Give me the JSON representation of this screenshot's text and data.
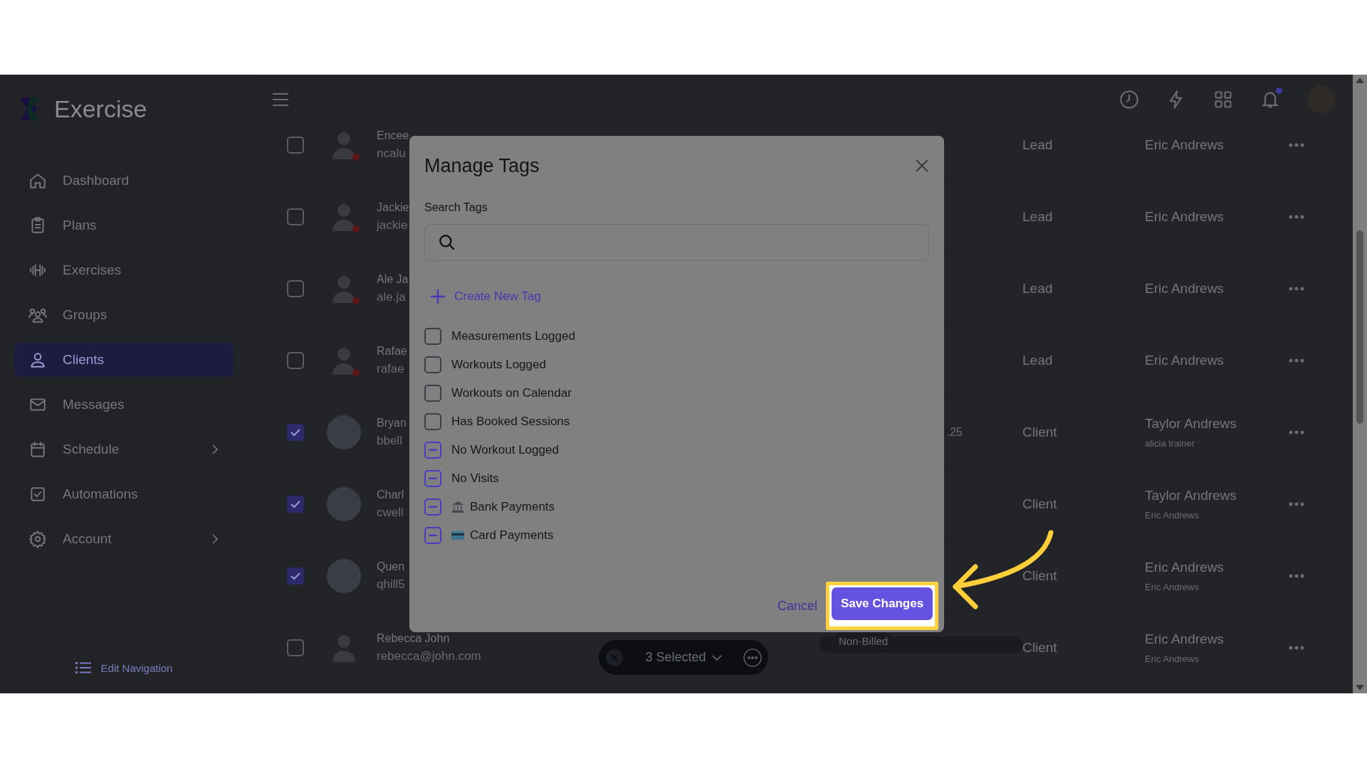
{
  "sidebar": {
    "brand": "Exercise",
    "items": [
      {
        "label": "Dashboard",
        "selected": false,
        "expandable": false
      },
      {
        "label": "Plans",
        "selected": false,
        "expandable": false
      },
      {
        "label": "Exercises",
        "selected": false,
        "expandable": false
      },
      {
        "label": "Groups",
        "selected": false,
        "expandable": false
      },
      {
        "label": "Clients",
        "selected": true,
        "expandable": false
      },
      {
        "label": "Messages",
        "selected": false,
        "expandable": false
      },
      {
        "label": "Schedule",
        "selected": false,
        "expandable": true
      },
      {
        "label": "Automations",
        "selected": false,
        "expandable": false
      },
      {
        "label": "Account",
        "selected": false,
        "expandable": true
      }
    ],
    "edit_navigation": "Edit Navigation"
  },
  "top_bar": {
    "notification_dot": true
  },
  "clients": [
    {
      "name": "Encee",
      "email": "ncalu",
      "selected": false,
      "alert": true,
      "kind": "silhouette",
      "type": "Lead",
      "trainer": "Eric Andrews"
    },
    {
      "name": "Jackie",
      "email": "jackie",
      "selected": false,
      "alert": true,
      "kind": "silhouette",
      "type": "Lead",
      "trainer": "Eric Andrews"
    },
    {
      "name": "Ale Ja",
      "email": "ale.ja",
      "selected": false,
      "alert": true,
      "kind": "silhouette",
      "type": "Lead",
      "trainer": "Eric Andrews"
    },
    {
      "name": "Rafae",
      "email": "rafae",
      "selected": false,
      "alert": true,
      "kind": "silhouette",
      "type": "Lead",
      "trainer": "Eric Andrews"
    },
    {
      "name": "Bryan",
      "email": "bbell",
      "selected": true,
      "alert": false,
      "kind": "photo",
      "extra": {
        "text": ".25",
        "kind": "text"
      },
      "type": "Client",
      "trainer": "Taylor Andrews",
      "trainer_note": "alicia trainer"
    },
    {
      "name": "Charl",
      "email": "cwell",
      "selected": true,
      "alert": false,
      "kind": "photo",
      "type": "Client",
      "trainer": "Taylor Andrews",
      "trainer_note": "Eric Andrews"
    },
    {
      "name": "Quen",
      "email": "qhill5",
      "selected": true,
      "alert": false,
      "kind": "photo",
      "type": "Client",
      "trainer": "Eric Andrews",
      "trainer_note": "Eric Andrews"
    },
    {
      "name": "Rebecca John",
      "email": "rebecca@john.com",
      "selected": false,
      "alert": false,
      "kind": "silhouette",
      "extra": {
        "text": "Non-Billed",
        "kind": "badge"
      },
      "type": "Client",
      "trainer": "Eric Andrews",
      "trainer_note": "Eric Andrews"
    }
  ],
  "selection_bar": {
    "label": "3 Selected"
  },
  "dialog": {
    "title": "Manage Tags",
    "search_label": "Search Tags",
    "create_label": "Create New Tag",
    "tags": [
      {
        "label": "Measurements Logged",
        "partial": false
      },
      {
        "label": "Workouts Logged",
        "partial": false
      },
      {
        "label": "Workouts on Calendar",
        "partial": false
      },
      {
        "label": "Has Booked Sessions",
        "partial": false
      },
      {
        "label": "No Workout Logged",
        "partial": true
      },
      {
        "label": "No Visits",
        "partial": true
      },
      {
        "label": "Bank Payments",
        "partial": true
      },
      {
        "label": "Card Payments",
        "partial": true
      }
    ],
    "cancel": "Cancel",
    "save": "Save Changes"
  }
}
